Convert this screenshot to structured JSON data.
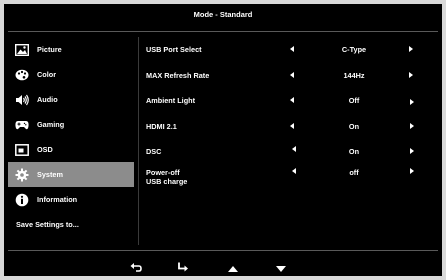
{
  "header": {
    "title": "Mode - Standard"
  },
  "sidebar": {
    "items": [
      {
        "label": "Picture",
        "icon": "picture-icon"
      },
      {
        "label": "Color",
        "icon": "palette-icon"
      },
      {
        "label": "Audio",
        "icon": "speaker-icon"
      },
      {
        "label": "Gaming",
        "icon": "gamepad-icon"
      },
      {
        "label": "OSD",
        "icon": "osd-icon"
      },
      {
        "label": "System",
        "icon": "gear-icon",
        "selected": true
      },
      {
        "label": "Information",
        "icon": "info-icon"
      },
      {
        "label": "Save Settings to..."
      }
    ]
  },
  "settings": [
    {
      "label": "USB Port Select",
      "value": "C-Type"
    },
    {
      "label": "MAX Refresh Rate",
      "value": "144Hz"
    },
    {
      "label": "Ambient Light",
      "value": "Off"
    },
    {
      "label": "HDMI 2.1",
      "value": "On"
    },
    {
      "label": "DSC",
      "value": "On"
    },
    {
      "label": "Power-off",
      "label2": "USB charge",
      "value": "off"
    }
  ],
  "footer": {
    "buttons": [
      "back-icon",
      "enter-icon",
      "up-icon",
      "down-icon"
    ]
  },
  "colors": {
    "background": "#000000",
    "selected_item": "#8c8c8c",
    "text": "#ffffff",
    "border": "#d9d9d9"
  }
}
